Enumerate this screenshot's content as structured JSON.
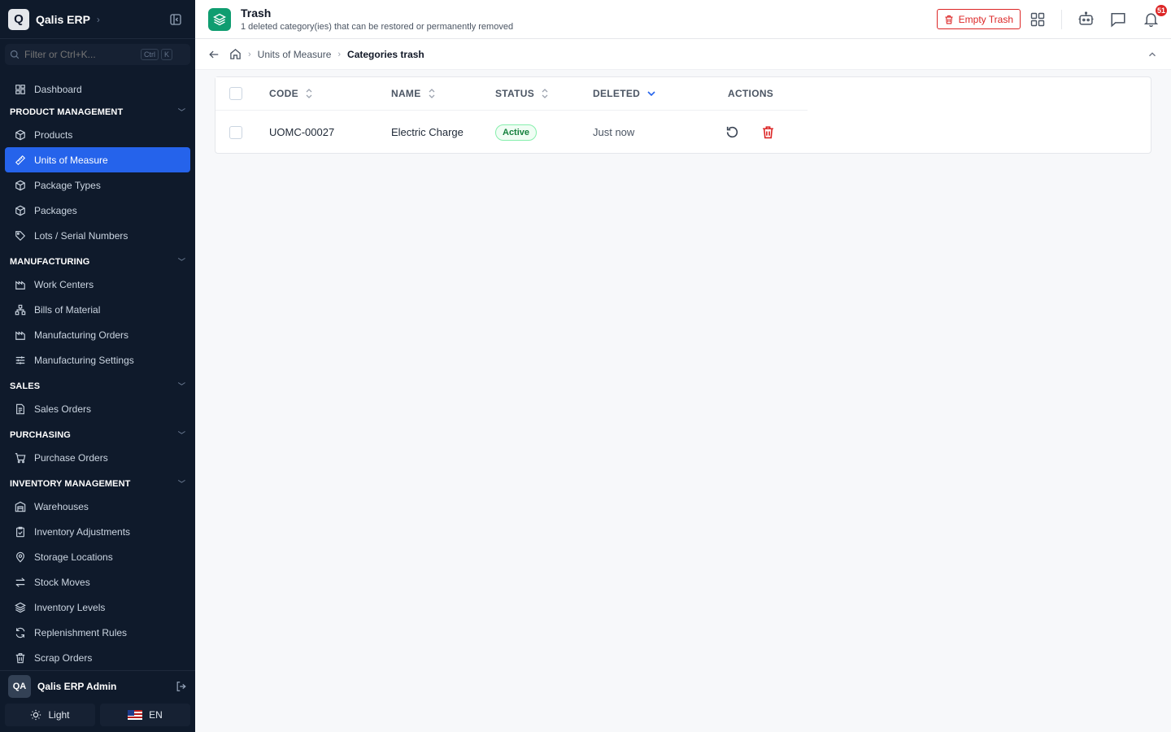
{
  "brand": {
    "logo_letter": "Q",
    "name": "Qalis ERP"
  },
  "filter": {
    "placeholder": "Filter or Ctrl+K...",
    "kbd1": "Ctrl",
    "kbd2": "K"
  },
  "nav": {
    "dashboard": "Dashboard",
    "sections": [
      {
        "title": "PRODUCT MANAGEMENT",
        "items": [
          "Products",
          "Units of Measure",
          "Package Types",
          "Packages",
          "Lots / Serial Numbers"
        ]
      },
      {
        "title": "MANUFACTURING",
        "items": [
          "Work Centers",
          "Bills of Material",
          "Manufacturing Orders",
          "Manufacturing Settings"
        ]
      },
      {
        "title": "SALES",
        "items": [
          "Sales Orders"
        ]
      },
      {
        "title": "PURCHASING",
        "items": [
          "Purchase Orders"
        ]
      },
      {
        "title": "INVENTORY MANAGEMENT",
        "items": [
          "Warehouses",
          "Inventory Adjustments",
          "Storage Locations",
          "Stock Moves",
          "Inventory Levels",
          "Replenishment Rules",
          "Scrap Orders"
        ]
      }
    ],
    "active_item": "Units of Measure"
  },
  "user": {
    "initials": "QA",
    "name": "Qalis ERP Admin"
  },
  "footer": {
    "theme_label": "Light",
    "lang_label": "EN"
  },
  "header": {
    "title": "Trash",
    "subtitle": "1 deleted category(ies) that can be restored or permanently removed",
    "empty_trash_label": "Empty Trash",
    "notification_count": "51",
    "accent_color": "#0f9d70"
  },
  "breadcrumb": {
    "parent": "Units of Measure",
    "current": "Categories trash"
  },
  "table": {
    "columns": {
      "code": "CODE",
      "name": "NAME",
      "status": "STATUS",
      "deleted": "DELETED",
      "actions": "ACTIONS"
    },
    "rows": [
      {
        "code": "UOMC-00027",
        "name": "Electric Charge",
        "status": "Active",
        "deleted": "Just now"
      }
    ]
  }
}
